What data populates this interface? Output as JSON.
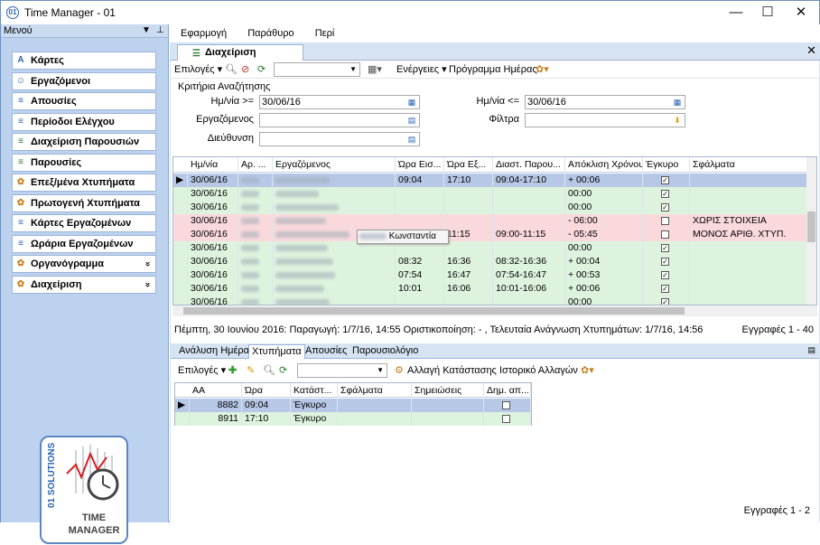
{
  "window": {
    "title": "Time Manager - 01",
    "icon_text": "01",
    "minimize": "—",
    "maximize": "☐",
    "close": "✕"
  },
  "sidebar": {
    "header": "Μενού",
    "items": [
      {
        "label": "Κάρτες",
        "icon": "card-icon",
        "glyph": "A"
      },
      {
        "label": "Εργαζόμενοι",
        "icon": "people-icon",
        "glyph": "☺"
      },
      {
        "label": "Απουσίες",
        "icon": "list-icon",
        "glyph": "≡"
      },
      {
        "label": "Περίοδοι Ελέγχου",
        "icon": "list-icon",
        "glyph": "≡"
      },
      {
        "label": "Διαχείριση Παρουσιών",
        "icon": "list-green-icon",
        "glyph": "≡"
      },
      {
        "label": "Παρουσίες",
        "icon": "list-green-icon",
        "glyph": "≡"
      },
      {
        "label": "Επεξ/μένα Χτυπήματα",
        "icon": "gears-icon",
        "glyph": "✿"
      },
      {
        "label": "Πρωτογενή Χτυπήματα",
        "icon": "gears-icon",
        "glyph": "✿"
      },
      {
        "label": "Κάρτες Εργαζομένων",
        "icon": "list-icon",
        "glyph": "≡"
      },
      {
        "label": "Ωράρια Εργαζομένων",
        "icon": "list-icon",
        "glyph": "≡"
      },
      {
        "label": "Οργανόγραμμα",
        "icon": "org-icon",
        "glyph": "✿",
        "expand": "»"
      },
      {
        "label": "Διαχείριση",
        "icon": "admin-icon",
        "glyph": "✿",
        "expand": "»"
      }
    ],
    "logo": {
      "brand": "01 SOLUTIONS",
      "line1": "TIME",
      "line2": "MANAGER"
    }
  },
  "menubar": [
    "Εφαρμογή",
    "Παράθυρο",
    "Περί"
  ],
  "doc_tab": {
    "label": "Διαχείριση Παρουσιών"
  },
  "toolbar": {
    "options": "Επιλογές ▾",
    "actions": "Ενέργειες ▾",
    "schedule": "Πρόγραμμα Ημέρας"
  },
  "criteria": {
    "title": "Κριτήρια Αναζήτησης",
    "date_from_label": "Ημ/νία >=",
    "date_from": "30/06/16",
    "date_to_label": "Ημ/νία <=",
    "date_to": "30/06/16",
    "employee_label": "Εργαζόμενος",
    "employee": "",
    "filter_label": "Φίλτρα",
    "filter": "",
    "department_label": "Διεύθυνση",
    "department": ""
  },
  "grid": {
    "columns": [
      "Ημ/νία",
      "Αρ. ...",
      "Εργαζόμενος",
      "Ώρα Εισ...",
      "Ώρα Εξ...",
      "Διαστ. Παρου...",
      "Απόκλιση Χρόνου",
      "Έγκυρο",
      "Σφάλματα"
    ],
    "rows": [
      {
        "date": "30/06/16",
        "in": "09:04",
        "out": "17:10",
        "interval": "09:04-17:10",
        "dev": "+ 00:06",
        "valid": true,
        "error": "",
        "status": "selected"
      },
      {
        "date": "30/06/16",
        "in": "",
        "out": "",
        "interval": "",
        "dev": "00:00",
        "valid": true,
        "error": "",
        "status": "ok"
      },
      {
        "date": "30/06/16",
        "in": "",
        "out": "",
        "interval": "",
        "dev": "00:00",
        "valid": true,
        "error": "",
        "status": "ok"
      },
      {
        "date": "30/06/16",
        "in": "",
        "out": "",
        "interval": "",
        "dev": "- 06:00",
        "valid": false,
        "error": "ΧΩΡΙΣ ΣΤΟΙΧΕΙΑ",
        "status": "error"
      },
      {
        "date": "30/06/16",
        "in": "",
        "out": "11:15",
        "interval": "09:00-11:15",
        "dev": "- 05:45",
        "valid": false,
        "error": "ΜΟΝΟΣ ΑΡΙΘ. ΧΤΥΠ.",
        "status": "error"
      },
      {
        "date": "30/06/16",
        "in": "",
        "out": "",
        "interval": "",
        "dev": "00:00",
        "valid": true,
        "error": "",
        "status": "ok"
      },
      {
        "date": "30/06/16",
        "in": "08:32",
        "out": "16:36",
        "interval": "08:32-16:36",
        "dev": "+ 00:04",
        "valid": true,
        "error": "",
        "status": "ok"
      },
      {
        "date": "30/06/16",
        "in": "07:54",
        "out": "16:47",
        "interval": "07:54-16:47",
        "dev": "+ 00:53",
        "valid": true,
        "error": "",
        "status": "ok"
      },
      {
        "date": "30/06/16",
        "in": "10:01",
        "out": "16:06",
        "interval": "10:01-16:06",
        "dev": "+ 00:06",
        "valid": true,
        "error": "",
        "status": "ok"
      },
      {
        "date": "30/06/16",
        "in": "",
        "out": "",
        "interval": "",
        "dev": "00:00",
        "valid": true,
        "error": "",
        "status": "ok"
      }
    ],
    "tooltip": "Κωνσταντία"
  },
  "status_line": {
    "left": "Πέμπτη, 30 Ιουνίου 2016:  Παραγωγή: 1/7/16, 14:55  Οριστικοποίηση: - , Τελευταία Ανάγνωση Χτυπημάτων: 1/7/16, 14:56",
    "right": "Εγγραφές 1 - 40"
  },
  "bottom_tabs": [
    "Ανάλυση Ημέρας",
    "Χτυπήματα",
    "Απουσίες",
    "Παρουσιολόγιο"
  ],
  "bottom_toolbar": {
    "options": "Επιλογές ▾",
    "change_state": "Αλλαγή Κατάστασης",
    "history": "Ιστορικό Αλλαγών"
  },
  "punches": {
    "columns": [
      "ΑΑ",
      "Ώρα",
      "Κατάστ...",
      "Σφάλματα",
      "Σημειώσεις",
      "Δημ. απ..."
    ],
    "rows": [
      {
        "aa": "8882",
        "time": "09:04",
        "state": "Έγκυρο",
        "selected": true
      },
      {
        "aa": "8911",
        "time": "17:10",
        "state": "Έγκυρο",
        "selected": false
      }
    ]
  },
  "bottom_status": "Εγγραφές 1 - 2",
  "colors": {
    "selected_row": "#b7c8e6",
    "ok_row": "#def3de",
    "error_row": "#f9d9dc",
    "sidebar_bg": "#bcd2ee"
  }
}
